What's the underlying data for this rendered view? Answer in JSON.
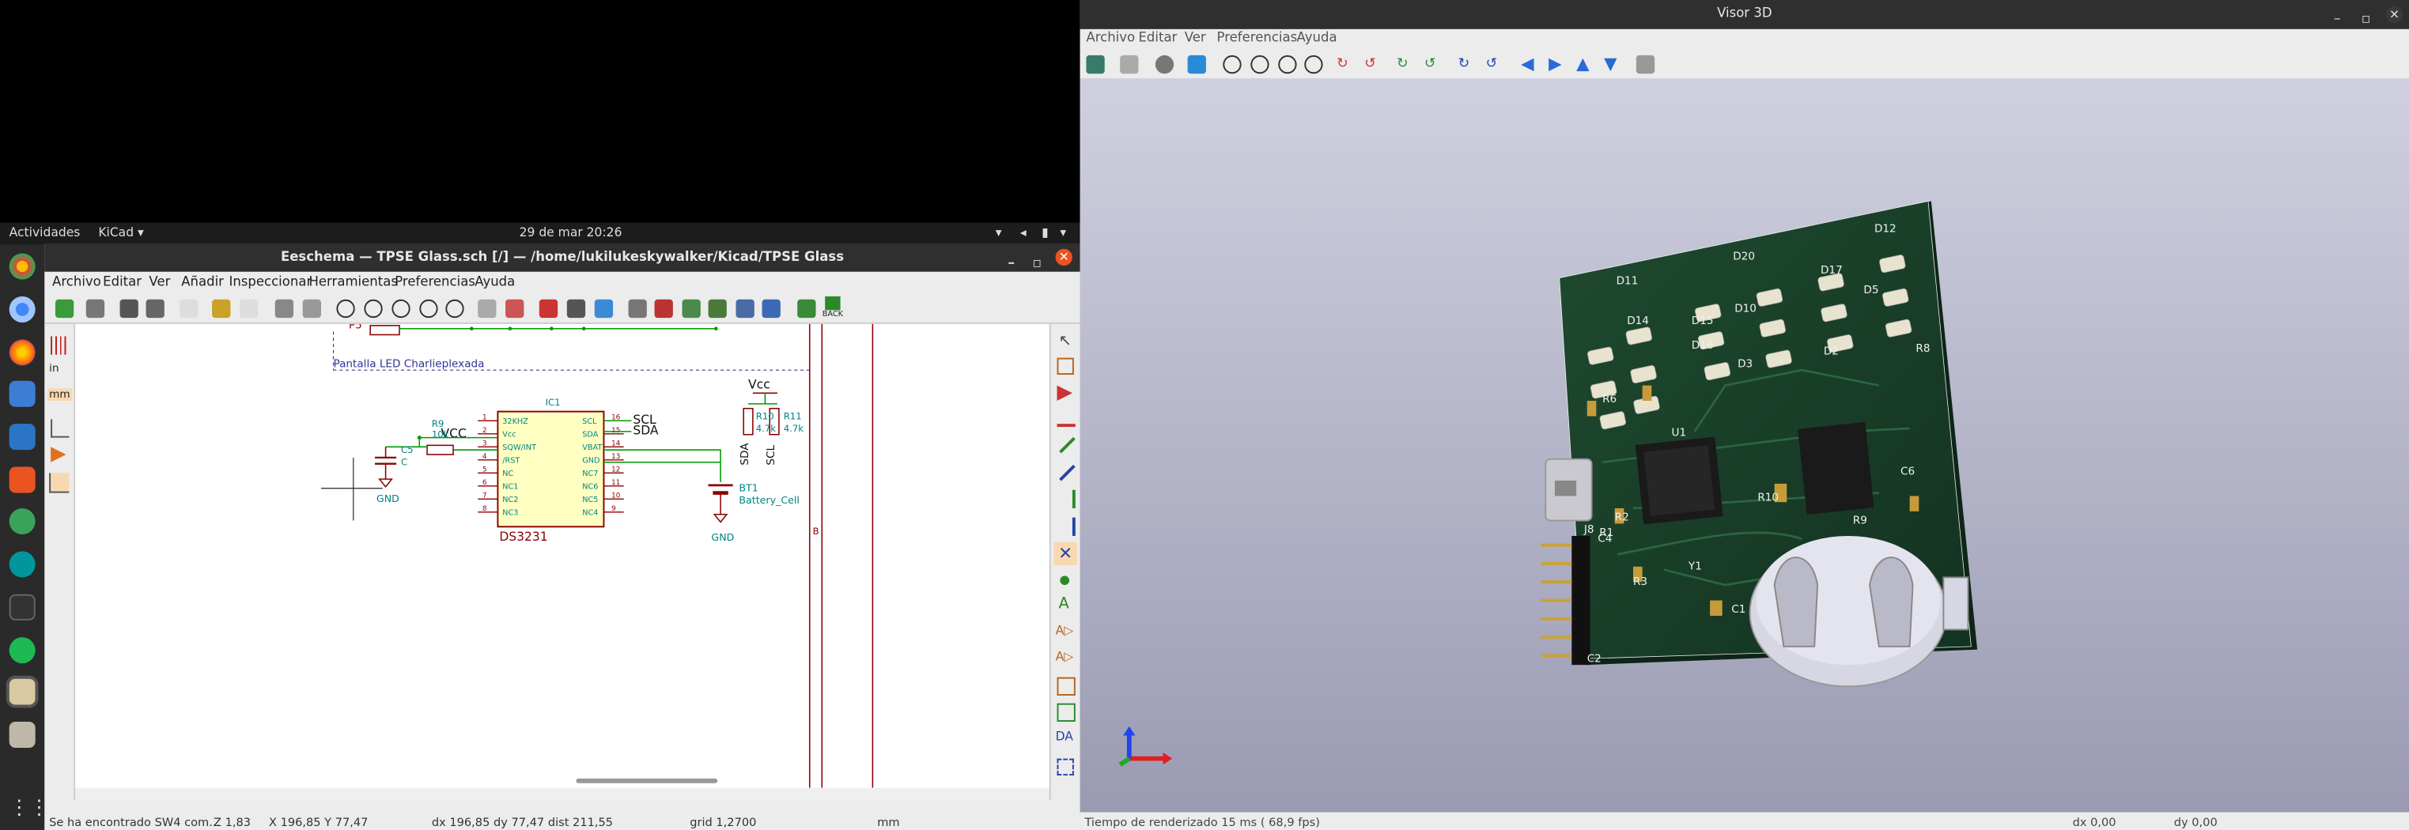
{
  "topbar": {
    "activities": "Actividades",
    "app": "KiCad ▾",
    "clock": "29 de mar  20:26"
  },
  "eeschema": {
    "title": "Eeschema — TPSE Glass.sch [/] — /home/lukilukeskywalker/Kicad/TPSE Glass",
    "menu": [
      "Archivo",
      "Editar",
      "Ver",
      "Añadir",
      "Inspeccionar",
      "Herramientas",
      "Preferencias",
      "Ayuda"
    ],
    "back_label": "BACK",
    "left_units": {
      "in": "in",
      "mm": "mm"
    },
    "schematic": {
      "sheet_label": "Pantalla LED Charlieplexada",
      "ic_ref": "IC1",
      "ic_value": "DS3231",
      "pins_left": [
        "32KHZ",
        "Vcc",
        "SQW/INT",
        "/RST",
        "NC",
        "NC1",
        "NC2",
        "NC3"
      ],
      "pins_left_num": [
        "1",
        "2",
        "3",
        "4",
        "5",
        "6",
        "7",
        "8"
      ],
      "pins_right": [
        "SCL",
        "SDA",
        "VBAT",
        "GND",
        "NC7",
        "NC6",
        "NC5",
        "NC4"
      ],
      "pins_right_num": [
        "16",
        "15",
        "14",
        "13",
        "12",
        "11",
        "10",
        "9"
      ],
      "net_scl": "SCL",
      "net_sda": "SDA",
      "vcc_left": "VCC",
      "vcc_right": "Vcc",
      "r9_ref": "R9",
      "r9_val": "10k",
      "c5_ref": "C5",
      "c5_val": "C",
      "gnd1": "GND",
      "gnd2": "GND",
      "bt1_ref": "BT1",
      "bt1_val": "Battery_Cell",
      "r10_ref": "R10",
      "r10_val": "4.7k",
      "r11_ref": "R11",
      "r11_val": "4.7k",
      "sda_vert": "SDA",
      "scl_vert": "SCL",
      "sheet_b": "B",
      "p5": "P5"
    },
    "status": {
      "message": "Se ha encontrado SW4 com...",
      "zoom": "Z 1,83",
      "coords": "X 196,85  Y 77,47",
      "delta": "dx 196,85  dy 77,47  dist 211,55",
      "grid": "grid 1,2700",
      "units": "mm"
    }
  },
  "viewer": {
    "title": "Visor 3D",
    "menu": [
      "Archivo",
      "Editar",
      "Ver",
      "Preferencias",
      "Ayuda"
    ],
    "status": {
      "render_time": "Tiempo de renderizado 15 ms ( 68,9 fps)",
      "dx": "dx 0,00",
      "dy": "dy 0,00"
    },
    "board_labels": [
      "D12",
      "D20",
      "D17",
      "D11",
      "D15",
      "D10",
      "D5",
      "D14",
      "D16",
      "D3",
      "D2",
      "R6",
      "U1",
      "R2",
      "R1",
      "C4",
      "J8",
      "R3",
      "Y1",
      "C1",
      "C2",
      "C6",
      "R9",
      "R10",
      "R8"
    ]
  },
  "colors": {
    "pcb": "#1c3b27",
    "wire": "#009900",
    "component": "#8b0000",
    "pin_text": "#008484",
    "accent": "#e95420"
  }
}
